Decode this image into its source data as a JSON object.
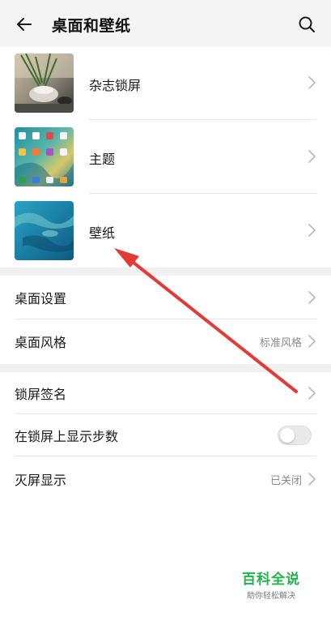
{
  "header": {
    "back_icon": "arrow-left-icon",
    "title": "桌面和壁纸",
    "search_icon": "search-icon"
  },
  "media_items": [
    {
      "label": "杂志锁屏",
      "thumb": "magazine-lockscreen-thumbnail"
    },
    {
      "label": "主题",
      "thumb": "theme-thumbnail"
    },
    {
      "label": "壁纸",
      "thumb": "wallpaper-thumbnail"
    }
  ],
  "desktop_section": [
    {
      "label": "桌面设置",
      "value": ""
    },
    {
      "label": "桌面风格",
      "value": "标准风格"
    }
  ],
  "lock_section": {
    "signature": {
      "label": "锁屏签名"
    },
    "steps": {
      "label": "在锁屏上显示步数",
      "enabled": false
    },
    "aod": {
      "label": "灭屏显示",
      "value": "已关闭"
    }
  },
  "watermark": {
    "brand": "百科全说",
    "tagline": "助你轻松解决"
  },
  "colors": {
    "header_bg": "#f4f4f4",
    "annotation_arrow": "#e53935",
    "watermark_green": "#1fb34a",
    "secondary_text": "#8a8a8a"
  }
}
